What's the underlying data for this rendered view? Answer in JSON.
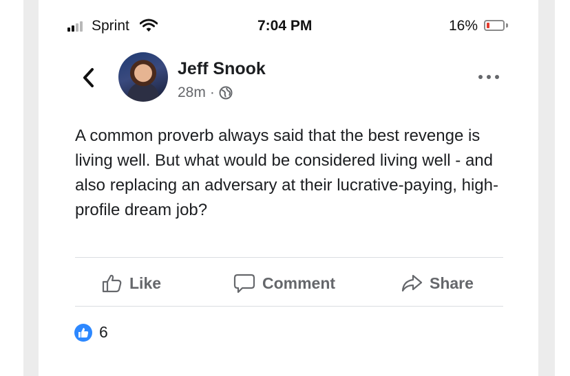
{
  "status_bar": {
    "carrier": "Sprint",
    "time": "7:04 PM",
    "battery_percent": "16%",
    "signal_bars": 2,
    "battery_level": 0.16,
    "battery_color": "#e23b2e"
  },
  "post": {
    "author": "Jeff Snook",
    "time_ago": "28m",
    "separator": "·",
    "audience_icon": "globe-icon",
    "text": "A common proverb always said that the best revenge is living well. But what would be considered living well - and also replacing an adversary at their lucrative-paying, high-profile dream job?"
  },
  "actions": {
    "like": "Like",
    "comment": "Comment",
    "share": "Share"
  },
  "reactions": {
    "icon": "like-reaction-icon",
    "count": "6",
    "color": "#2d88ff"
  }
}
